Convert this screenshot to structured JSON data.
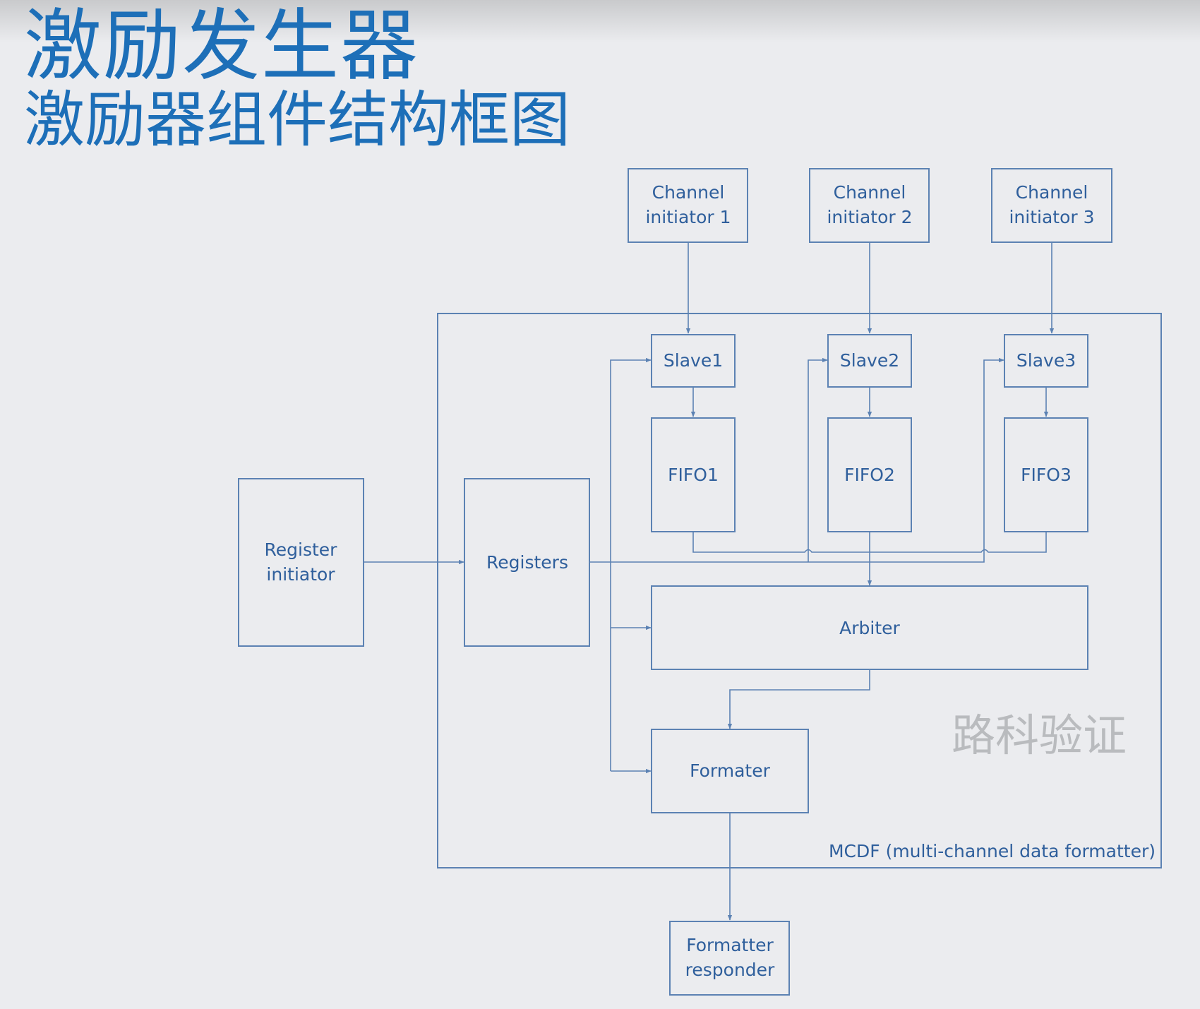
{
  "title": "激励发生器",
  "subtitle": "激励器组件结构框图",
  "watermark": "路科验证",
  "container_label": "MCDF (multi-channel data formatter)",
  "blocks": {
    "channel_initiator_1": [
      "Channel",
      "initiator 1"
    ],
    "channel_initiator_2": [
      "Channel",
      "initiator 2"
    ],
    "channel_initiator_3": [
      "Channel",
      "initiator 3"
    ],
    "slave1": "Slave1",
    "slave2": "Slave2",
    "slave3": "Slave3",
    "fifo1": "FIFO1",
    "fifo2": "FIFO2",
    "fifo3": "FIFO3",
    "register_initiator": [
      "Register",
      "initiator"
    ],
    "registers": "Registers",
    "arbiter": "Arbiter",
    "formater": "Formater",
    "formatter_responder": [
      "Formatter",
      "responder"
    ]
  },
  "colors": {
    "title": "#1d6fb8",
    "box_stroke": "#5c82b3",
    "label": "#2f5f9c",
    "background": "#ebecef",
    "watermark": "#b9bbbe"
  }
}
